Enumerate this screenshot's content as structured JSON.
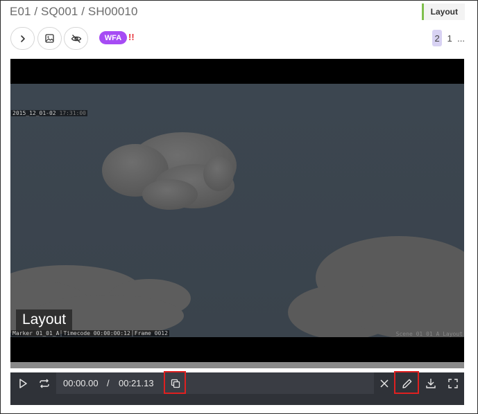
{
  "header": {
    "breadcrumb": "E01 / SQ001 / SH00010",
    "task_type": "Layout",
    "task_color": "#7fbf4d"
  },
  "toolbar": {
    "buttons": [
      {
        "icon": "chevron-right-icon"
      },
      {
        "icon": "image-icon"
      },
      {
        "icon": "eye-off-icon"
      }
    ],
    "status_badge": "WFA",
    "status_color": "#a64bf4",
    "priority_marker": "!!"
  },
  "pagination": {
    "current": "2",
    "next": "1",
    "more": "..."
  },
  "viewer": {
    "overlay_top_date": "2015_12_01-02",
    "overlay_top_time": "17:31:00",
    "overlay_marker": "Marker 01_01_A",
    "overlay_timecode": "Timecode 00:00:00:12",
    "overlay_frame": "Frame 0012",
    "overlay_scene": "Scene 01 01 A Layout",
    "task_label": "Layout"
  },
  "controls": {
    "current_time": "00:00.00",
    "separator": "/",
    "total_time": "00:21.13"
  }
}
